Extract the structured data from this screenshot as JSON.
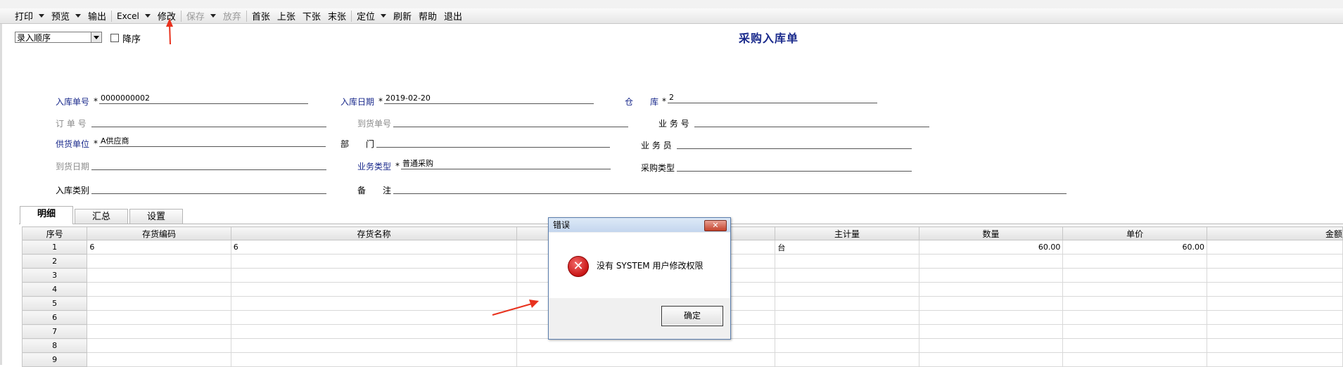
{
  "toolbar": {
    "items": [
      {
        "label": "打印",
        "caret": true,
        "disabled": false
      },
      {
        "label": "预览",
        "caret": true,
        "disabled": false
      },
      {
        "label": "输出",
        "caret": false,
        "disabled": false
      },
      {
        "label": "Excel",
        "caret": true,
        "disabled": false
      },
      {
        "label": "修改",
        "caret": false,
        "disabled": false
      },
      {
        "label": "保存",
        "caret": true,
        "disabled": true
      },
      {
        "label": "放弃",
        "caret": false,
        "disabled": true
      },
      {
        "label": "首张",
        "caret": false,
        "disabled": false
      },
      {
        "label": "上张",
        "caret": false,
        "disabled": false
      },
      {
        "label": "下张",
        "caret": false,
        "disabled": false
      },
      {
        "label": "末张",
        "caret": false,
        "disabled": false
      },
      {
        "label": "定位",
        "caret": true,
        "disabled": false
      },
      {
        "label": "刷新",
        "caret": false,
        "disabled": false
      },
      {
        "label": "帮助",
        "caret": false,
        "disabled": false
      },
      {
        "label": "退出",
        "caret": false,
        "disabled": false
      }
    ]
  },
  "controls": {
    "sort_select": "录入顺序",
    "desc_label": "降序"
  },
  "form": {
    "title": "采购入库单",
    "fields": {
      "receipt_no": {
        "label": "入库单号",
        "value": "0000000002"
      },
      "receipt_date": {
        "label": "入库日期",
        "value": "2019-02-20"
      },
      "warehouse": {
        "label": "仓　　库",
        "value": "2"
      },
      "order_no": {
        "label": "订 单 号",
        "value": ""
      },
      "arrival_no": {
        "label": "到货单号",
        "value": ""
      },
      "business_no": {
        "label": "业 务 号",
        "value": ""
      },
      "supplier": {
        "label": "供货单位",
        "value": "A供应商"
      },
      "department": {
        "label": "部　　门",
        "value": ""
      },
      "salesman": {
        "label": "业 务 员",
        "value": ""
      },
      "arrival_date": {
        "label": "到货日期",
        "value": ""
      },
      "business_type": {
        "label": "业务类型",
        "value": "普通采购"
      },
      "purchase_type": {
        "label": "采购类型",
        "value": ""
      },
      "receipt_category": {
        "label": "入库类别",
        "value": ""
      },
      "remarks": {
        "label": "备　　注",
        "value": ""
      }
    },
    "required_mark": "*"
  },
  "tabs": [
    "明细",
    "汇总",
    "设置"
  ],
  "grid": {
    "columns": [
      "序号",
      "存货编码",
      "存货名称",
      "",
      "主计量",
      "数量",
      "单价",
      "金额"
    ],
    "rows": [
      [
        "1",
        "6",
        "6",
        "",
        "台",
        "60.00",
        "60.00",
        ""
      ],
      [
        "2",
        "",
        "",
        "",
        "",
        "",
        "",
        ""
      ],
      [
        "3",
        "",
        "",
        "",
        "",
        "",
        "",
        ""
      ],
      [
        "4",
        "",
        "",
        "",
        "",
        "",
        "",
        ""
      ],
      [
        "5",
        "",
        "",
        "",
        "",
        "",
        "",
        ""
      ],
      [
        "6",
        "",
        "",
        "",
        "",
        "",
        "",
        ""
      ],
      [
        "7",
        "",
        "",
        "",
        "",
        "",
        "",
        ""
      ],
      [
        "8",
        "",
        "",
        "",
        "",
        "",
        "",
        ""
      ],
      [
        "9",
        "",
        "",
        "",
        "",
        "",
        "",
        ""
      ]
    ]
  },
  "dialog": {
    "title": "错误",
    "close_label": "✕",
    "message": "没有 SYSTEM 用户修改权限",
    "ok_label": "确定"
  },
  "colors": {
    "required_label": "#1a2a8c",
    "annotation_arrow": "#e8321e"
  }
}
